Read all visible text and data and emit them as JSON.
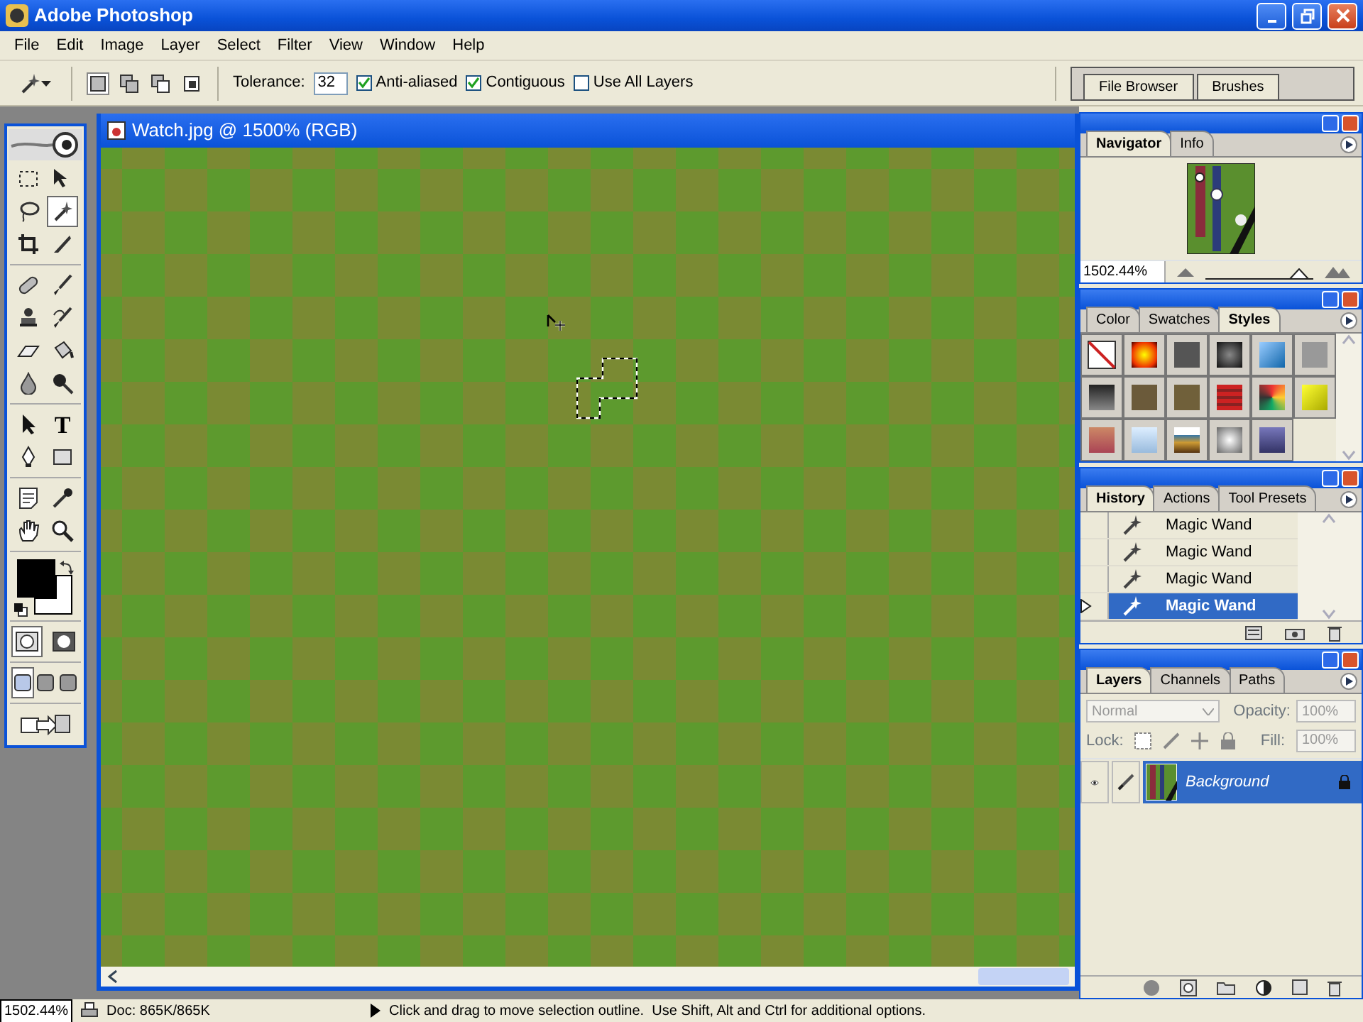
{
  "window": {
    "title": "Adobe Photoshop"
  },
  "menu": [
    "File",
    "Edit",
    "Image",
    "Layer",
    "Select",
    "Filter",
    "View",
    "Window",
    "Help"
  ],
  "options_bar": {
    "selection_modes": [
      {
        "selected": true
      },
      {
        "selected": false
      },
      {
        "selected": false
      },
      {
        "selected": false
      }
    ],
    "tolerance": {
      "label": "Tolerance:",
      "value": "32"
    },
    "checkboxes": [
      {
        "label": "Anti-aliased",
        "checked": true
      },
      {
        "label": "Contiguous",
        "checked": true
      },
      {
        "label": "Use All Layers",
        "checked": false
      }
    ]
  },
  "palette_well": {
    "tabs": [
      "File Browser",
      "Brushes"
    ]
  },
  "toolbox": {
    "tools": [
      {
        "kind": "marquee",
        "selected": false
      },
      {
        "kind": "move",
        "selected": false
      },
      {
        "kind": "lasso",
        "selected": false
      },
      {
        "kind": "magic-wand",
        "selected": true
      },
      {
        "kind": "crop",
        "selected": false
      },
      {
        "kind": "slice",
        "selected": false
      },
      {
        "kind": "healing",
        "selected": false
      },
      {
        "kind": "brush",
        "selected": false
      },
      {
        "kind": "stamp",
        "selected": false
      },
      {
        "kind": "history-brush",
        "selected": false
      },
      {
        "kind": "eraser",
        "selected": false
      },
      {
        "kind": "bucket",
        "selected": false
      },
      {
        "kind": "blur",
        "selected": false
      },
      {
        "kind": "dodge",
        "selected": false
      },
      {
        "kind": "path-select",
        "selected": false
      },
      {
        "kind": "type",
        "glyph": "T",
        "selected": false
      },
      {
        "kind": "pen",
        "selected": false
      },
      {
        "kind": "shape",
        "selected": false
      },
      {
        "kind": "notes",
        "selected": false
      },
      {
        "kind": "eyedropper",
        "selected": false
      },
      {
        "kind": "hand",
        "selected": false
      },
      {
        "kind": "zoom",
        "selected": false
      }
    ],
    "color_swatches": [
      {
        "kind": "foreground",
        "color": "#000000"
      },
      {
        "kind": "background",
        "color": "#ffffff"
      }
    ],
    "mask_modes": [
      {
        "selected": true
      },
      {
        "selected": false
      }
    ],
    "screen_modes": [
      {
        "selected": true
      },
      {
        "selected": false
      },
      {
        "selected": false
      }
    ]
  },
  "document": {
    "title": "Watch.jpg @ 1500% (RGB)"
  },
  "navigator": {
    "tabs": [
      {
        "label": "Navigator",
        "selected": true
      },
      {
        "label": "Info",
        "selected": false
      }
    ],
    "zoom": "1502.44%",
    "zoom_slider": {
      "level": 0.95
    }
  },
  "styles_panel": {
    "tabs": [
      {
        "label": "Color",
        "selected": false
      },
      {
        "label": "Swatches",
        "selected": false
      },
      {
        "label": "Styles",
        "selected": true
      }
    ]
  },
  "history": {
    "tabs": [
      {
        "label": "History",
        "selected": true
      },
      {
        "label": "Actions",
        "selected": false
      },
      {
        "label": "Tool Presets",
        "selected": false
      }
    ],
    "items": [
      {
        "label": "Magic Wand",
        "selected": false
      },
      {
        "label": "Magic Wand",
        "selected": false
      },
      {
        "label": "Magic Wand",
        "selected": false
      },
      {
        "label": "Magic Wand",
        "selected": true
      }
    ]
  },
  "layers": {
    "tabs": [
      {
        "label": "Layers",
        "selected": true
      },
      {
        "label": "Channels",
        "selected": false
      },
      {
        "label": "Paths",
        "selected": false
      }
    ],
    "blend_mode": "Normal",
    "opacity_label": "Opacity:",
    "opacity": "100%",
    "lock_label": "Lock:",
    "fill_label": "Fill:",
    "fill": "100%",
    "items": [
      {
        "name": "Background",
        "selected": true,
        "visible": true,
        "locked": true
      }
    ]
  },
  "status_bar": {
    "zoom": "1502.44%",
    "doc": "Doc: 865K/865K",
    "message": "Click and drag to move selection outline.  Use Shift, Alt and Ctrl for additional options."
  }
}
